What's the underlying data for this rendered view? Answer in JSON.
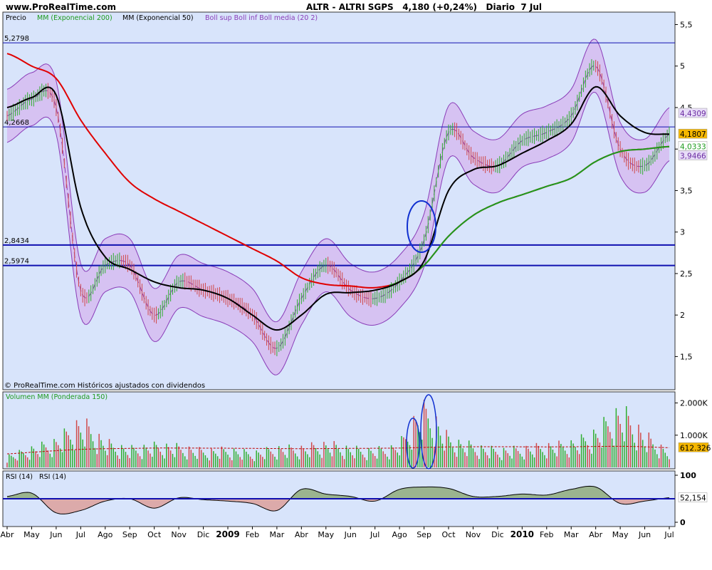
{
  "header": {
    "site": "www.ProRealTime.com",
    "symbol": "ALTR - ALTRI SGPS",
    "price": "4,180 (+0,24%)",
    "frequency": "Diario",
    "date": "7 Jul"
  },
  "colors": {
    "panel_bg": "#d8e4fb",
    "boll_fill": "#d6c2f2",
    "boll_line": "#8a3cb8",
    "ma200": "#e00000",
    "ma50": "#000000",
    "exp200_legend": "#1d9b1d",
    "volume_up": "#2fae2f",
    "volume_down": "#d04a4a",
    "level_line": "#1010b0",
    "circle": "#1030d0",
    "rsi_up_fill": "#9bb48f",
    "rsi_down_fill": "#dcaaaa"
  },
  "price_panel": {
    "legend": {
      "precio": "Precio",
      "mm200": "MM (Exponencial 200)",
      "mm50": "MM (Exponencial 50)",
      "boll": "Boll sup Boll inf Boll media (20 2)"
    },
    "footer": "© ProRealTime.com  Históricos ajustados con dividendos",
    "y_ticks": [
      "5,5",
      "5",
      "4,5",
      "4",
      "3,5",
      "3",
      "2,5",
      "2",
      "1,5"
    ],
    "levels": [
      {
        "label": "5,2798",
        "value": 5.2798
      },
      {
        "label": "4,2668",
        "value": 4.2668
      },
      {
        "label": "2,8434",
        "value": 2.8434
      },
      {
        "label": "2,5974",
        "value": 2.5974
      }
    ],
    "right_labels": [
      {
        "text": "4,4309",
        "value": 4.4309,
        "bg": "#e8ddf8",
        "fg": "#6a2aa0"
      },
      {
        "text": "4,1807",
        "value": 4.1807,
        "bg": "#f5b700",
        "fg": "#000000"
      },
      {
        "text": "4,0333",
        "value": 4.0333,
        "bg": "#ffffff",
        "fg": "#1d9b1d"
      },
      {
        "text": "3,9466",
        "value": 3.9466,
        "bg": "#e8ddf8",
        "fg": "#6a2aa0"
      }
    ]
  },
  "volume_panel": {
    "legend": "Volumen MM (Ponderada 150)",
    "y_ticks": [
      "2.000K",
      "1.000K"
    ],
    "last_label": "612.326"
  },
  "rsi_panel": {
    "legend_a": "RSI (14)",
    "legend_b": "RSI (14)",
    "y_ticks": [
      "100",
      "0"
    ],
    "last_label": "52,154"
  },
  "x_axis": {
    "labels": [
      "Abr",
      "May",
      "Jun",
      "Jul",
      "Ago",
      "Sep",
      "Oct",
      "Nov",
      "Dic",
      "2009",
      "Feb",
      "Mar",
      "Abr",
      "May",
      "Jun",
      "Jul",
      "Ago",
      "Sep",
      "Oct",
      "Nov",
      "Dic",
      "2010",
      "Feb",
      "Mar",
      "Abr",
      "May",
      "Jun",
      "Jul"
    ]
  },
  "chart_data": [
    {
      "type": "line",
      "name": "Precio",
      "x": [
        "Abr",
        "May",
        "Jun",
        "Jul",
        "Ago",
        "Sep",
        "Oct",
        "Nov",
        "Dic",
        "2009",
        "Feb",
        "Mar",
        "Abr",
        "May",
        "Jun",
        "Jul",
        "Ago",
        "Sep",
        "Oct",
        "Nov",
        "Dic",
        "2010",
        "Feb",
        "Mar",
        "Abr",
        "May",
        "Jun",
        "Jul"
      ],
      "ylim": [
        1.1,
        5.65
      ],
      "series": [
        {
          "name": "Precio",
          "values": [
            4.4,
            4.6,
            4.5,
            2.3,
            2.6,
            2.6,
            2.0,
            2.4,
            2.3,
            2.2,
            2.0,
            1.6,
            2.2,
            2.6,
            2.3,
            2.2,
            2.4,
            2.9,
            4.2,
            3.9,
            3.8,
            4.1,
            4.2,
            4.4,
            5.0,
            4.0,
            3.8,
            4.18
          ]
        },
        {
          "name": "MM (Exponencial 200)",
          "values": [
            5.15,
            5.0,
            4.85,
            4.35,
            3.95,
            3.6,
            3.4,
            3.25,
            3.1,
            2.95,
            2.8,
            2.65,
            2.45,
            2.37,
            2.35,
            2.33,
            2.4,
            2.6,
            2.95,
            3.2,
            3.35,
            3.45,
            3.55,
            3.65,
            3.85,
            3.97,
            4.0,
            4.03
          ]
        },
        {
          "name": "MM (Exponencial 50)",
          "values": [
            4.5,
            4.62,
            4.65,
            3.3,
            2.7,
            2.55,
            2.4,
            2.33,
            2.3,
            2.2,
            2.0,
            1.82,
            2.0,
            2.25,
            2.27,
            2.3,
            2.4,
            2.65,
            3.5,
            3.75,
            3.8,
            3.95,
            4.1,
            4.3,
            4.75,
            4.4,
            4.2,
            4.18
          ]
        }
      ]
    },
    {
      "type": "bar",
      "name": "Volumen",
      "x": [
        "Abr",
        "May",
        "Jun",
        "Jul",
        "Ago",
        "Sep",
        "Oct",
        "Nov",
        "Dic",
        "2009",
        "Feb",
        "Mar",
        "Abr",
        "May",
        "Jun",
        "Jul",
        "Ago",
        "Sep",
        "Oct",
        "Nov",
        "Dic",
        "2010",
        "Feb",
        "Mar",
        "Abr",
        "May",
        "Jun",
        "Jul"
      ],
      "ylim": [
        0,
        2300
      ],
      "values": [
        420,
        700,
        980,
        1600,
        950,
        700,
        800,
        750,
        620,
        650,
        550,
        700,
        720,
        850,
        700,
        650,
        900,
        2100,
        1100,
        800,
        650,
        700,
        800,
        900,
        1300,
        2000,
        1200,
        612
      ],
      "ma_values": [
        420,
        470,
        520,
        560,
        580,
        590,
        600,
        600,
        598,
        596,
        590,
        585,
        582,
        585,
        590,
        595,
        600,
        620,
        635,
        640,
        642,
        640,
        638,
        640,
        650,
        655,
        640,
        612
      ]
    },
    {
      "type": "area",
      "name": "RSI (14)",
      "x": [
        "Abr",
        "May",
        "Jun",
        "Jul",
        "Ago",
        "Sep",
        "Oct",
        "Nov",
        "Dic",
        "2009",
        "Feb",
        "Mar",
        "Abr",
        "May",
        "Jun",
        "Jul",
        "Ago",
        "Sep",
        "Oct",
        "Nov",
        "Dic",
        "2010",
        "Feb",
        "Mar",
        "Abr",
        "May",
        "Jun",
        "Jul"
      ],
      "ylim": [
        0,
        100
      ],
      "midline": 50,
      "values": [
        55,
        62,
        20,
        25,
        45,
        50,
        30,
        52,
        48,
        45,
        40,
        25,
        70,
        60,
        55,
        45,
        70,
        75,
        72,
        55,
        55,
        60,
        58,
        70,
        75,
        40,
        45,
        52.154
      ]
    }
  ]
}
